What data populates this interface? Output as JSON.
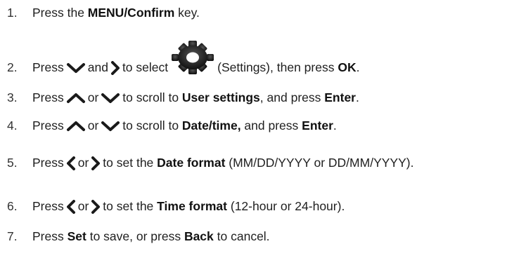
{
  "steps": [
    {
      "num": "1.",
      "parts": {
        "a": "Press the ",
        "b": "MENU/Confirm",
        "c": " key."
      }
    },
    {
      "num": "2.",
      "parts": {
        "a": "Press",
        "b": "and",
        "c": "to select",
        "d": "(Settings), then press ",
        "e": "OK",
        "f": "."
      }
    },
    {
      "num": "3.",
      "parts": {
        "a": "Press",
        "b": "or",
        "c": "to scroll to ",
        "d": "User settings",
        "e": ", and press ",
        "f": "Enter",
        "g": "."
      }
    },
    {
      "num": "4.",
      "parts": {
        "a": "Press",
        "b": "or",
        "c": "to scroll to ",
        "d": "Date/time,",
        "e": " and press ",
        "f": "Enter",
        "g": "."
      }
    },
    {
      "num": "5.",
      "parts": {
        "a": "Press",
        "b": "or",
        "c": "to  set the ",
        "d": "Date format",
        "e": " (MM/DD/YYYY or DD/MM/YYYY)."
      }
    },
    {
      "num": "6.",
      "parts": {
        "a": "Press",
        "b": "or",
        "c": "to  set the ",
        "d": "Time format",
        "e": " (12-hour or 24-hour)."
      }
    },
    {
      "num": "7.",
      "parts": {
        "a": "Press ",
        "b": "Set",
        "c": " to save, or press ",
        "d": "Back",
        "e": " to cancel."
      }
    }
  ],
  "icons": {
    "down": "chevron-down-icon",
    "up": "chevron-up-icon",
    "left": "chevron-left-icon",
    "right": "chevron-right-icon",
    "gear": "gear-icon"
  },
  "colors": {
    "text": "#1f1f1f",
    "icon": "#1a1a1a",
    "gear": "#202020"
  }
}
